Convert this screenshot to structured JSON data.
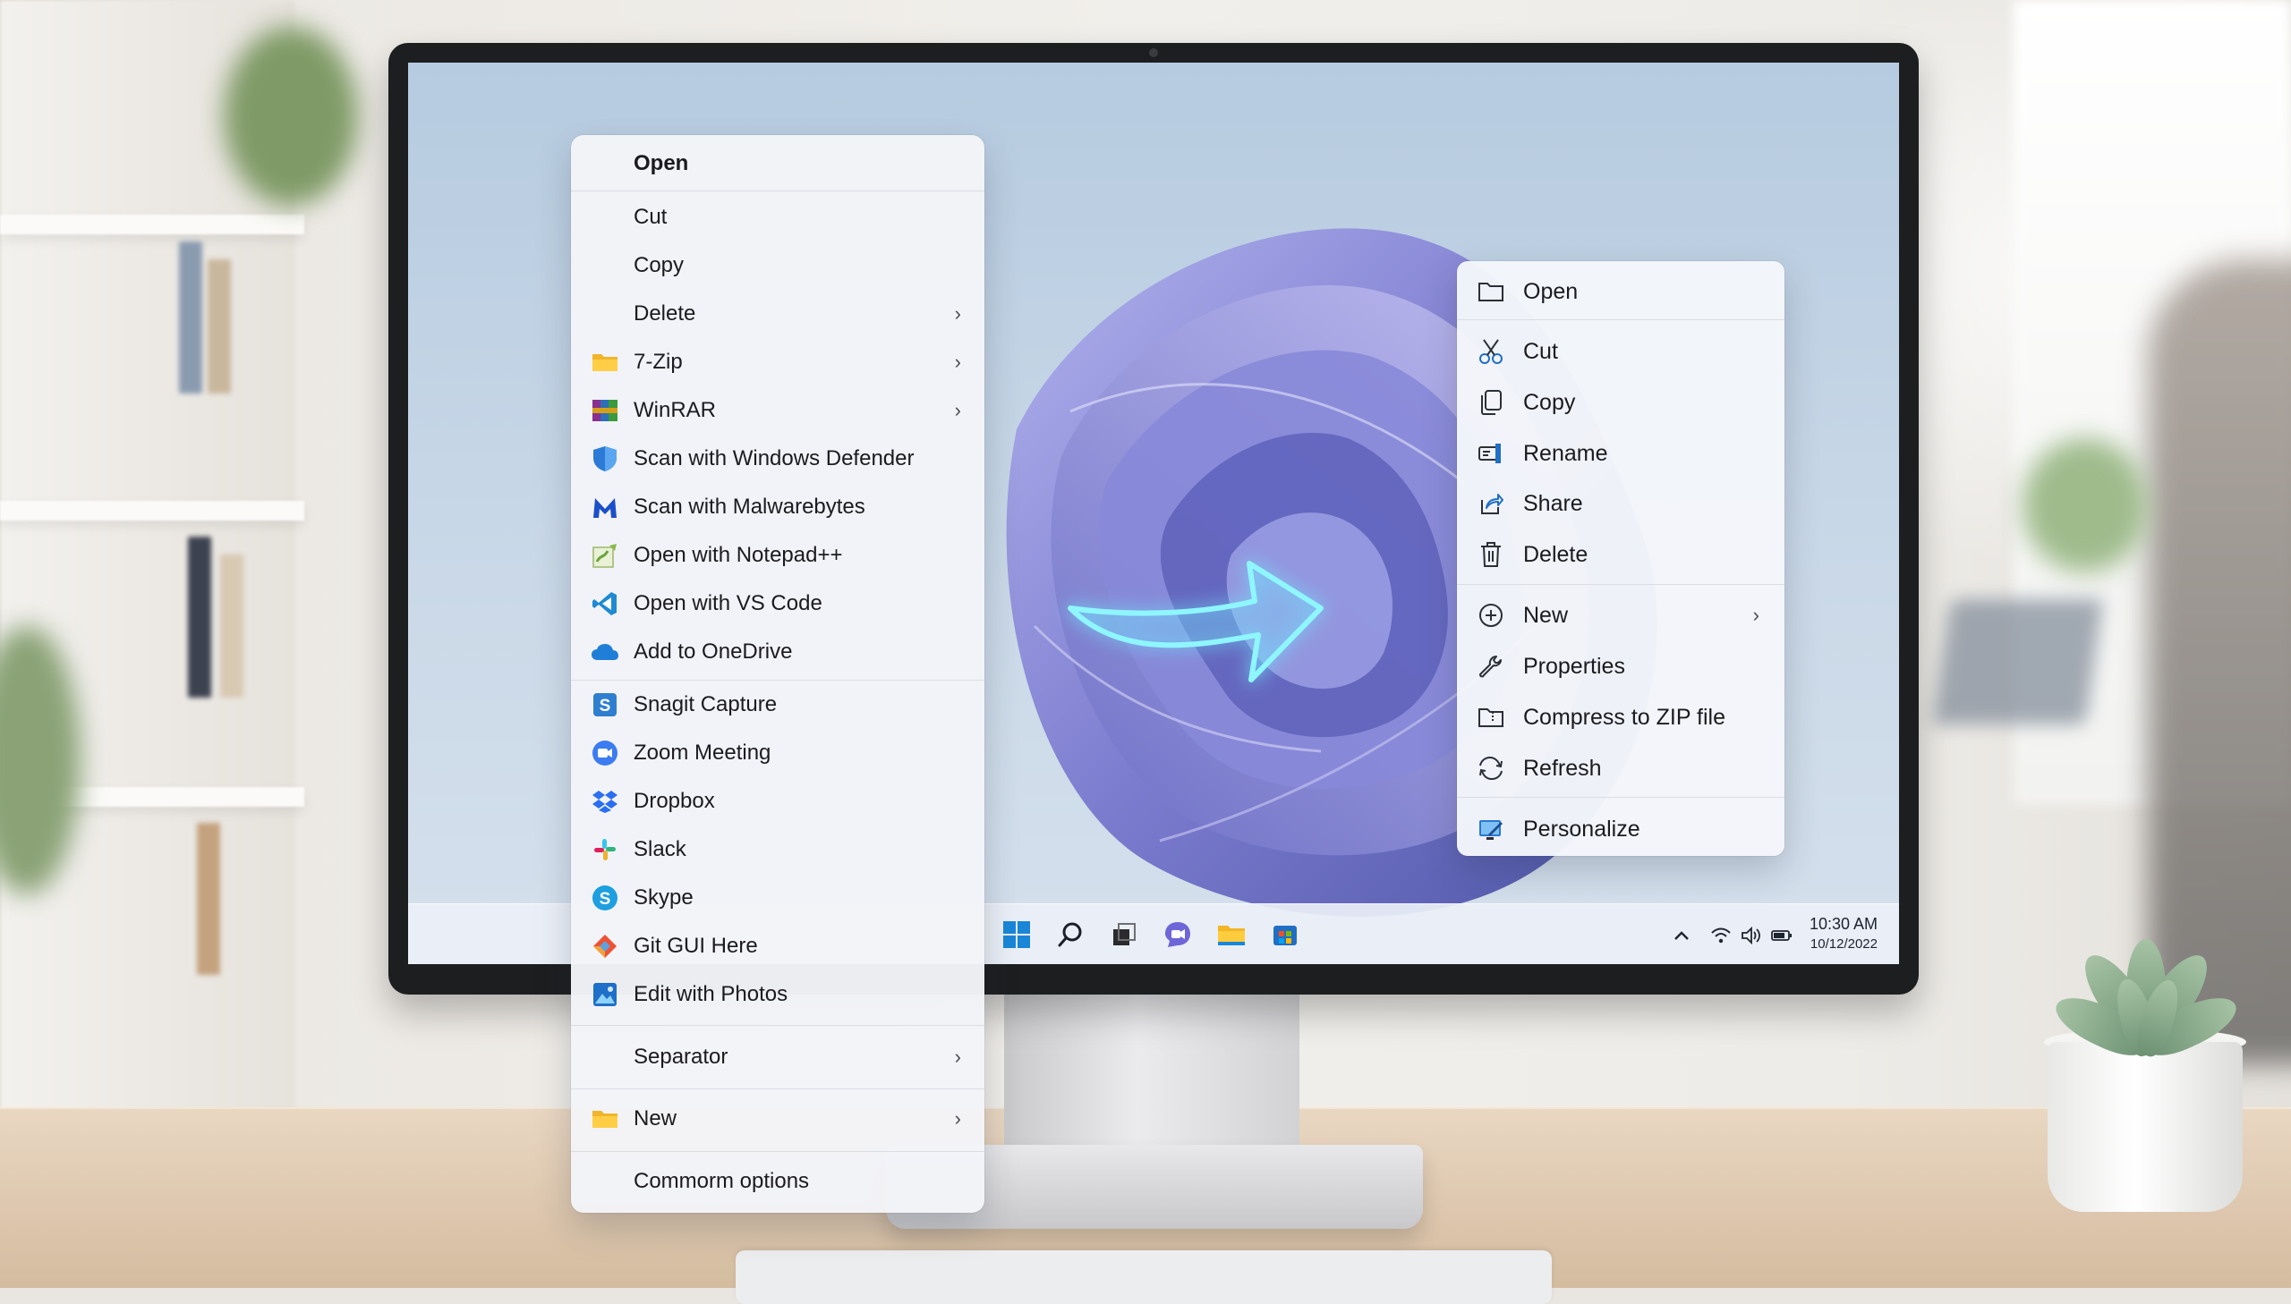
{
  "left_menu": {
    "items": [
      {
        "label": "Open",
        "icon": "none",
        "bold": true
      },
      {
        "label": "Cut",
        "icon": "none"
      },
      {
        "label": "Copy",
        "icon": "none"
      },
      {
        "label": "Delete",
        "icon": "none",
        "submenu": true
      },
      {
        "label": "7-Zip",
        "icon": "folder-icon",
        "submenu": true
      },
      {
        "label": "WinRAR",
        "icon": "winrar-icon",
        "submenu": true
      },
      {
        "label": "Scan with Windows Defender",
        "icon": "defender-shield-icon"
      },
      {
        "label": "Scan with Malwarebytes",
        "icon": "malwarebytes-icon"
      },
      {
        "label": "Open with Notepad++",
        "icon": "notepad-plus-plus-icon"
      },
      {
        "label": "Open with VS Code",
        "icon": "vscode-icon"
      },
      {
        "label": "Add to OneDrive",
        "icon": "onedrive-cloud-icon"
      },
      {
        "label": "Snagit Capture",
        "icon": "snagit-icon"
      },
      {
        "label": "Zoom Meeting",
        "icon": "zoom-icon"
      },
      {
        "label": "Dropbox",
        "icon": "dropbox-icon"
      },
      {
        "label": "Slack",
        "icon": "slack-icon"
      },
      {
        "label": "Skype",
        "icon": "skype-icon"
      },
      {
        "label": "Git GUI Here",
        "icon": "git-icon"
      },
      {
        "label": "Edit with Photos",
        "icon": "photos-icon"
      },
      {
        "label": "Separator",
        "icon": "none",
        "submenu": true
      },
      {
        "label": "New",
        "icon": "folder-icon",
        "submenu": true
      },
      {
        "label": "Commorm options",
        "icon": "none"
      }
    ],
    "chevron": "›"
  },
  "right_menu": {
    "items": [
      {
        "label": "Open",
        "icon": "folder-outline-icon"
      },
      {
        "label": "Cut",
        "icon": "scissors-icon"
      },
      {
        "label": "Copy",
        "icon": "copy-icon"
      },
      {
        "label": "Rename",
        "icon": "rename-icon"
      },
      {
        "label": "Share",
        "icon": "share-icon"
      },
      {
        "label": "Delete",
        "icon": "trash-icon"
      },
      {
        "label": "New",
        "icon": "new-plus-icon",
        "submenu": true
      },
      {
        "label": "Properties",
        "icon": "wrench-icon"
      },
      {
        "label": "Compress to ZIP file",
        "icon": "zip-folder-icon"
      },
      {
        "label": "Refresh",
        "icon": "refresh-icon"
      },
      {
        "label": "Personalize",
        "icon": "personalize-icon"
      }
    ],
    "chevron": "›"
  },
  "taskbar": {
    "apps": [
      "windows-start-icon",
      "search-icon",
      "task-view-icon",
      "teams-chat-icon",
      "file-explorer-icon",
      "microsoft-store-icon"
    ],
    "tray": [
      "chevron-up-icon",
      "wifi-icon",
      "volume-icon",
      "battery-icon"
    ],
    "time": "10:30 AM",
    "date": "10/12/2022"
  },
  "colors": {
    "accent": "#0067c0",
    "wallpaper_bloom": "#7f7fd4",
    "arrow_glow": "#7ff3ff"
  }
}
